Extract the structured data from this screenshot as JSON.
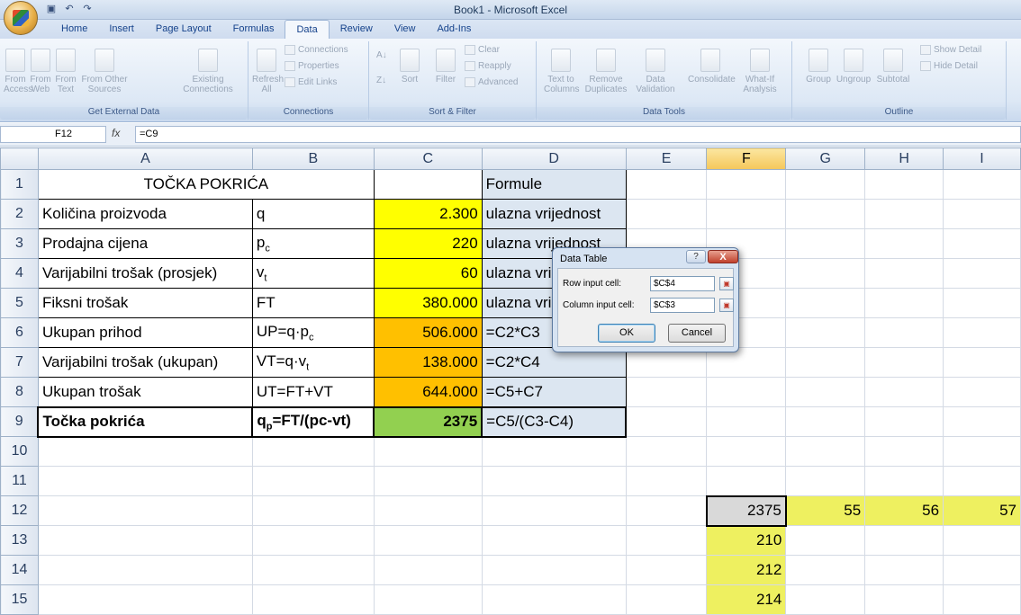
{
  "window": {
    "title": "Book1 - Microsoft Excel"
  },
  "tabs": [
    "Home",
    "Insert",
    "Page Layout",
    "Formulas",
    "Data",
    "Review",
    "View",
    "Add-Ins"
  ],
  "active_tab": "Data",
  "ribbon": {
    "get_external_data": {
      "label": "Get External Data",
      "from_access": "From Access",
      "from_web": "From Web",
      "from_text": "From Text",
      "from_other": "From Other Sources",
      "existing": "Existing Connections"
    },
    "connections": {
      "label": "Connections",
      "refresh": "Refresh All",
      "connections": "Connections",
      "properties": "Properties",
      "edit_links": "Edit Links"
    },
    "sort_filter": {
      "label": "Sort & Filter",
      "sort": "Sort",
      "filter": "Filter",
      "clear": "Clear",
      "reapply": "Reapply",
      "advanced": "Advanced"
    },
    "data_tools": {
      "label": "Data Tools",
      "text_to_columns": "Text to Columns",
      "remove_duplicates": "Remove Duplicates",
      "data_validation": "Data Validation",
      "consolidate": "Consolidate",
      "what_if": "What-If Analysis"
    },
    "outline": {
      "label": "Outline",
      "group": "Group",
      "ungroup": "Ungroup",
      "subtotal": "Subtotal",
      "show_detail": "Show Detail",
      "hide_detail": "Hide Detail"
    }
  },
  "formula_bar": {
    "name_box": "F12",
    "fx": "fx",
    "formula": "=C9"
  },
  "columns": [
    "A",
    "B",
    "C",
    "D",
    "E",
    "F",
    "G",
    "H",
    "I"
  ],
  "rows": {
    "r1": {
      "num": "1",
      "title": "TOČKA POKRIĆA",
      "d": "Formule"
    },
    "r2": {
      "num": "2",
      "a": "Količina proizvoda",
      "b": "q",
      "c": "2.300",
      "d": "ulazna vrijednost"
    },
    "r3": {
      "num": "3",
      "a": "Prodajna cijena",
      "b_main": "p",
      "b_sub": "c",
      "c": "220",
      "d": "ulazna vrijednost"
    },
    "r4": {
      "num": "4",
      "a": "Varijabilni trošak (prosjek)",
      "b_main": "v",
      "b_sub": "t",
      "c": "60",
      "d": "ulazna vri"
    },
    "r5": {
      "num": "5",
      "a": "Fiksni trošak",
      "b": "FT",
      "c": "380.000",
      "d": "ulazna vri"
    },
    "r6": {
      "num": "6",
      "a": "Ukupan prihod",
      "b_main": "UP=q·p",
      "b_sub": "c",
      "c": "506.000",
      "d": "=C2*C3"
    },
    "r7": {
      "num": "7",
      "a": "Varijabilni trošak (ukupan)",
      "b_main": "VT=q·v",
      "b_sub": "t",
      "c": "138.000",
      "d": "=C2*C4"
    },
    "r8": {
      "num": "8",
      "a": "Ukupan trošak",
      "b": "UT=FT+VT",
      "c": "644.000",
      "d": "=C5+C7"
    },
    "r9": {
      "num": "9",
      "a": "Točka pokrića",
      "b_main": "q",
      "b_sub": "p",
      "b_rest": "=FT/(pc-vt)",
      "c": "2375",
      "d": "=C5/(C3-C4)"
    },
    "r10": {
      "num": "10"
    },
    "r11": {
      "num": "11"
    },
    "r12": {
      "num": "12",
      "f": "2375",
      "g": "55",
      "h": "56",
      "i": "57"
    },
    "r13": {
      "num": "13",
      "f": "210"
    },
    "r14": {
      "num": "14",
      "f": "212"
    },
    "r15": {
      "num": "15",
      "f": "214"
    }
  },
  "dialog": {
    "title": "Data Table",
    "help": "?",
    "close": "X",
    "row_label": "Row input cell:",
    "row_value": "$C$4",
    "col_label": "Column input cell:",
    "col_value": "$C$3",
    "ok": "OK",
    "cancel": "Cancel"
  }
}
